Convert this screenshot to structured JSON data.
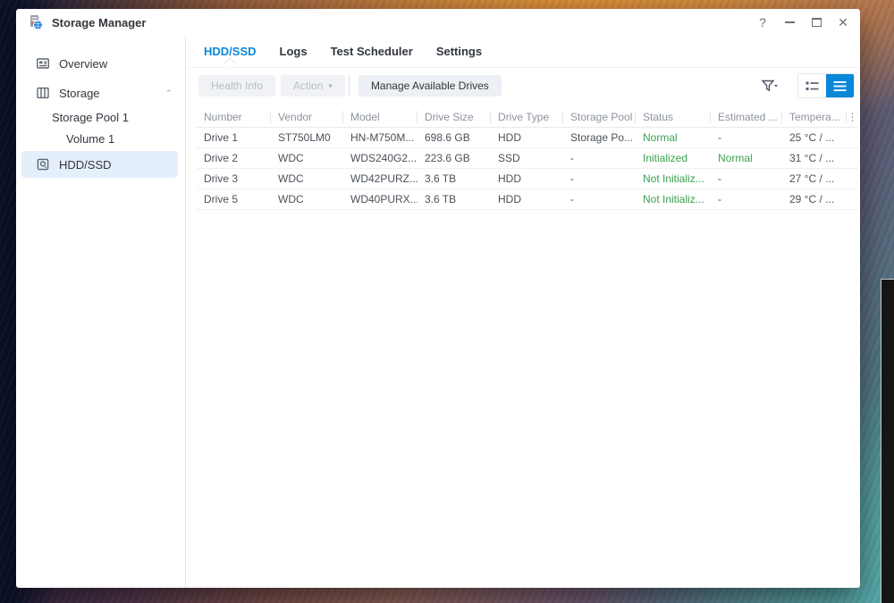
{
  "colors": {
    "accent_blue": "#0b87da",
    "status_green": "#3aa24e",
    "selected_item_bg": "#e4effb"
  },
  "window": {
    "title": "Storage Manager",
    "help_icon": "?",
    "close_icon": "✕"
  },
  "sidebar": {
    "items": [
      {
        "label": "Overview"
      },
      {
        "label": "Storage"
      },
      {
        "label": "Storage Pool 1"
      },
      {
        "label": "Volume 1"
      },
      {
        "label": "HDD/SSD"
      }
    ]
  },
  "tabs": {
    "active": "HDD/SSD",
    "items": [
      {
        "label": "HDD/SSD"
      },
      {
        "label": "Logs"
      },
      {
        "label": "Test Scheduler"
      },
      {
        "label": "Settings"
      }
    ]
  },
  "toolbar": {
    "health_info": "Health Info",
    "action": "Action",
    "action_caret": "▾",
    "manage": "Manage Available Drives"
  },
  "table": {
    "columns": [
      {
        "label": "Number"
      },
      {
        "label": "Vendor"
      },
      {
        "label": "Model"
      },
      {
        "label": "Drive Size"
      },
      {
        "label": "Drive Type"
      },
      {
        "label": "Storage Pool"
      },
      {
        "label": "Status"
      },
      {
        "label": "Estimated ..."
      },
      {
        "label": "Tempera..."
      }
    ],
    "options_icon": "⋮",
    "rows": [
      {
        "cells": [
          {
            "text": "Drive 1"
          },
          {
            "text": "ST750LM0"
          },
          {
            "text": "HN-M750M..."
          },
          {
            "text": "698.6 GB"
          },
          {
            "text": "HDD"
          },
          {
            "text": "Storage Po..."
          },
          {
            "text": "Normal",
            "green": true
          },
          {
            "text": "-"
          },
          {
            "text": "25 °C / ..."
          }
        ]
      },
      {
        "cells": [
          {
            "text": "Drive 2"
          },
          {
            "text": "WDC"
          },
          {
            "text": "WDS240G2..."
          },
          {
            "text": "223.6 GB"
          },
          {
            "text": "SSD"
          },
          {
            "text": "-"
          },
          {
            "text": "Initialized",
            "green": true
          },
          {
            "text": "Normal",
            "green": true
          },
          {
            "text": "31 °C / ..."
          }
        ]
      },
      {
        "cells": [
          {
            "text": "Drive 3"
          },
          {
            "text": "WDC"
          },
          {
            "text": "WD42PURZ..."
          },
          {
            "text": "3.6 TB"
          },
          {
            "text": "HDD"
          },
          {
            "text": "-"
          },
          {
            "text": "Not Initializ...",
            "green": true
          },
          {
            "text": "-"
          },
          {
            "text": "27 °C / ..."
          }
        ]
      },
      {
        "cells": [
          {
            "text": "Drive 5"
          },
          {
            "text": "WDC"
          },
          {
            "text": "WD40PURX..."
          },
          {
            "text": "3.6 TB"
          },
          {
            "text": "HDD"
          },
          {
            "text": "-"
          },
          {
            "text": "Not Initializ...",
            "green": true
          },
          {
            "text": "-"
          },
          {
            "text": "29 °C / ..."
          }
        ]
      }
    ]
  }
}
